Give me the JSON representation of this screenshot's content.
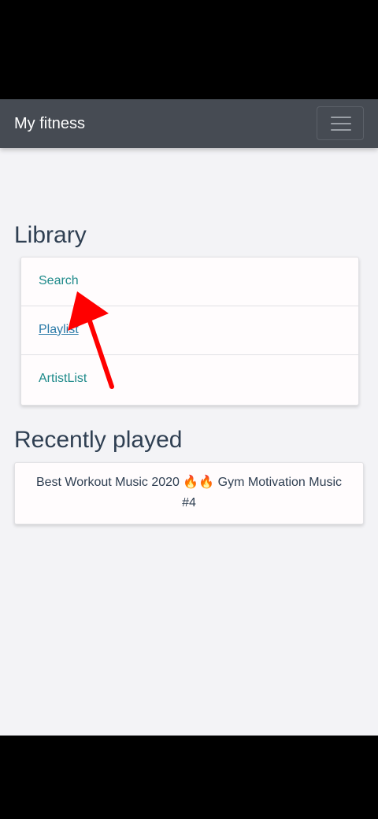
{
  "navbar": {
    "brand": "My fitness",
    "menu_icon": "hamburger-menu-icon"
  },
  "library": {
    "heading": "Library",
    "items": [
      {
        "label": "Search"
      },
      {
        "label": "Playlist"
      },
      {
        "label": "ArtistList"
      }
    ]
  },
  "recent": {
    "heading": "Recently played",
    "items": [
      {
        "title": "Best Workout Music 2020 🔥🔥 Gym Motivation Music #4"
      }
    ]
  },
  "annotation": {
    "arrow_icon": "red-arrow-icon",
    "color": "#ff0000"
  },
  "colors": {
    "navbar_bg": "#464b53",
    "page_bg": "#f3f3f6",
    "link": "#1e8a8a",
    "heading": "#2f3f52"
  }
}
